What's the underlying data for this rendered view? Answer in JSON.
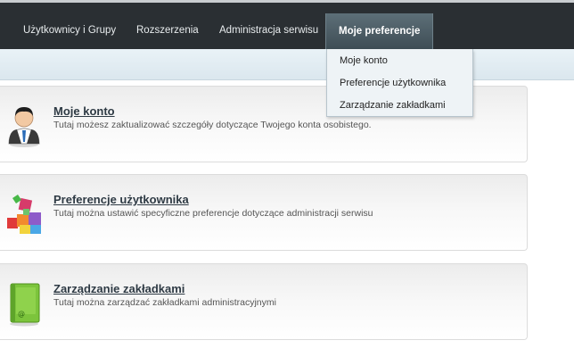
{
  "nav": {
    "items": [
      {
        "label": "Użytkownicy i Grupy"
      },
      {
        "label": "Rozszerzenia"
      },
      {
        "label": "Administracja serwisu"
      },
      {
        "label": "Moje preferencje"
      }
    ]
  },
  "dropdown": {
    "items": [
      {
        "label": "Moje konto"
      },
      {
        "label": "Preferencje użytkownika"
      },
      {
        "label": "Zarządzanie zakładkami"
      }
    ]
  },
  "panels": [
    {
      "title": "Moje konto",
      "desc": "Tutaj możesz zaktualizować szczegóły dotyczące Twojego konta osobistego.",
      "icon": "user-account-icon"
    },
    {
      "title": "Preferencje użytkownika",
      "desc": "Tutaj można ustawić specyficzne preferencje dotyczące administracji serwisu",
      "icon": "colored-blocks-icon"
    },
    {
      "title": "Zarządzanie zakładkami",
      "desc": "Tutaj można zarządzać zakładkami administracyjnymi",
      "icon": "green-book-icon"
    }
  ],
  "colors": {
    "topbar": "#2a2f33",
    "active_tab": "#4d5e67",
    "dropdown_bg": "#eef3f6"
  }
}
